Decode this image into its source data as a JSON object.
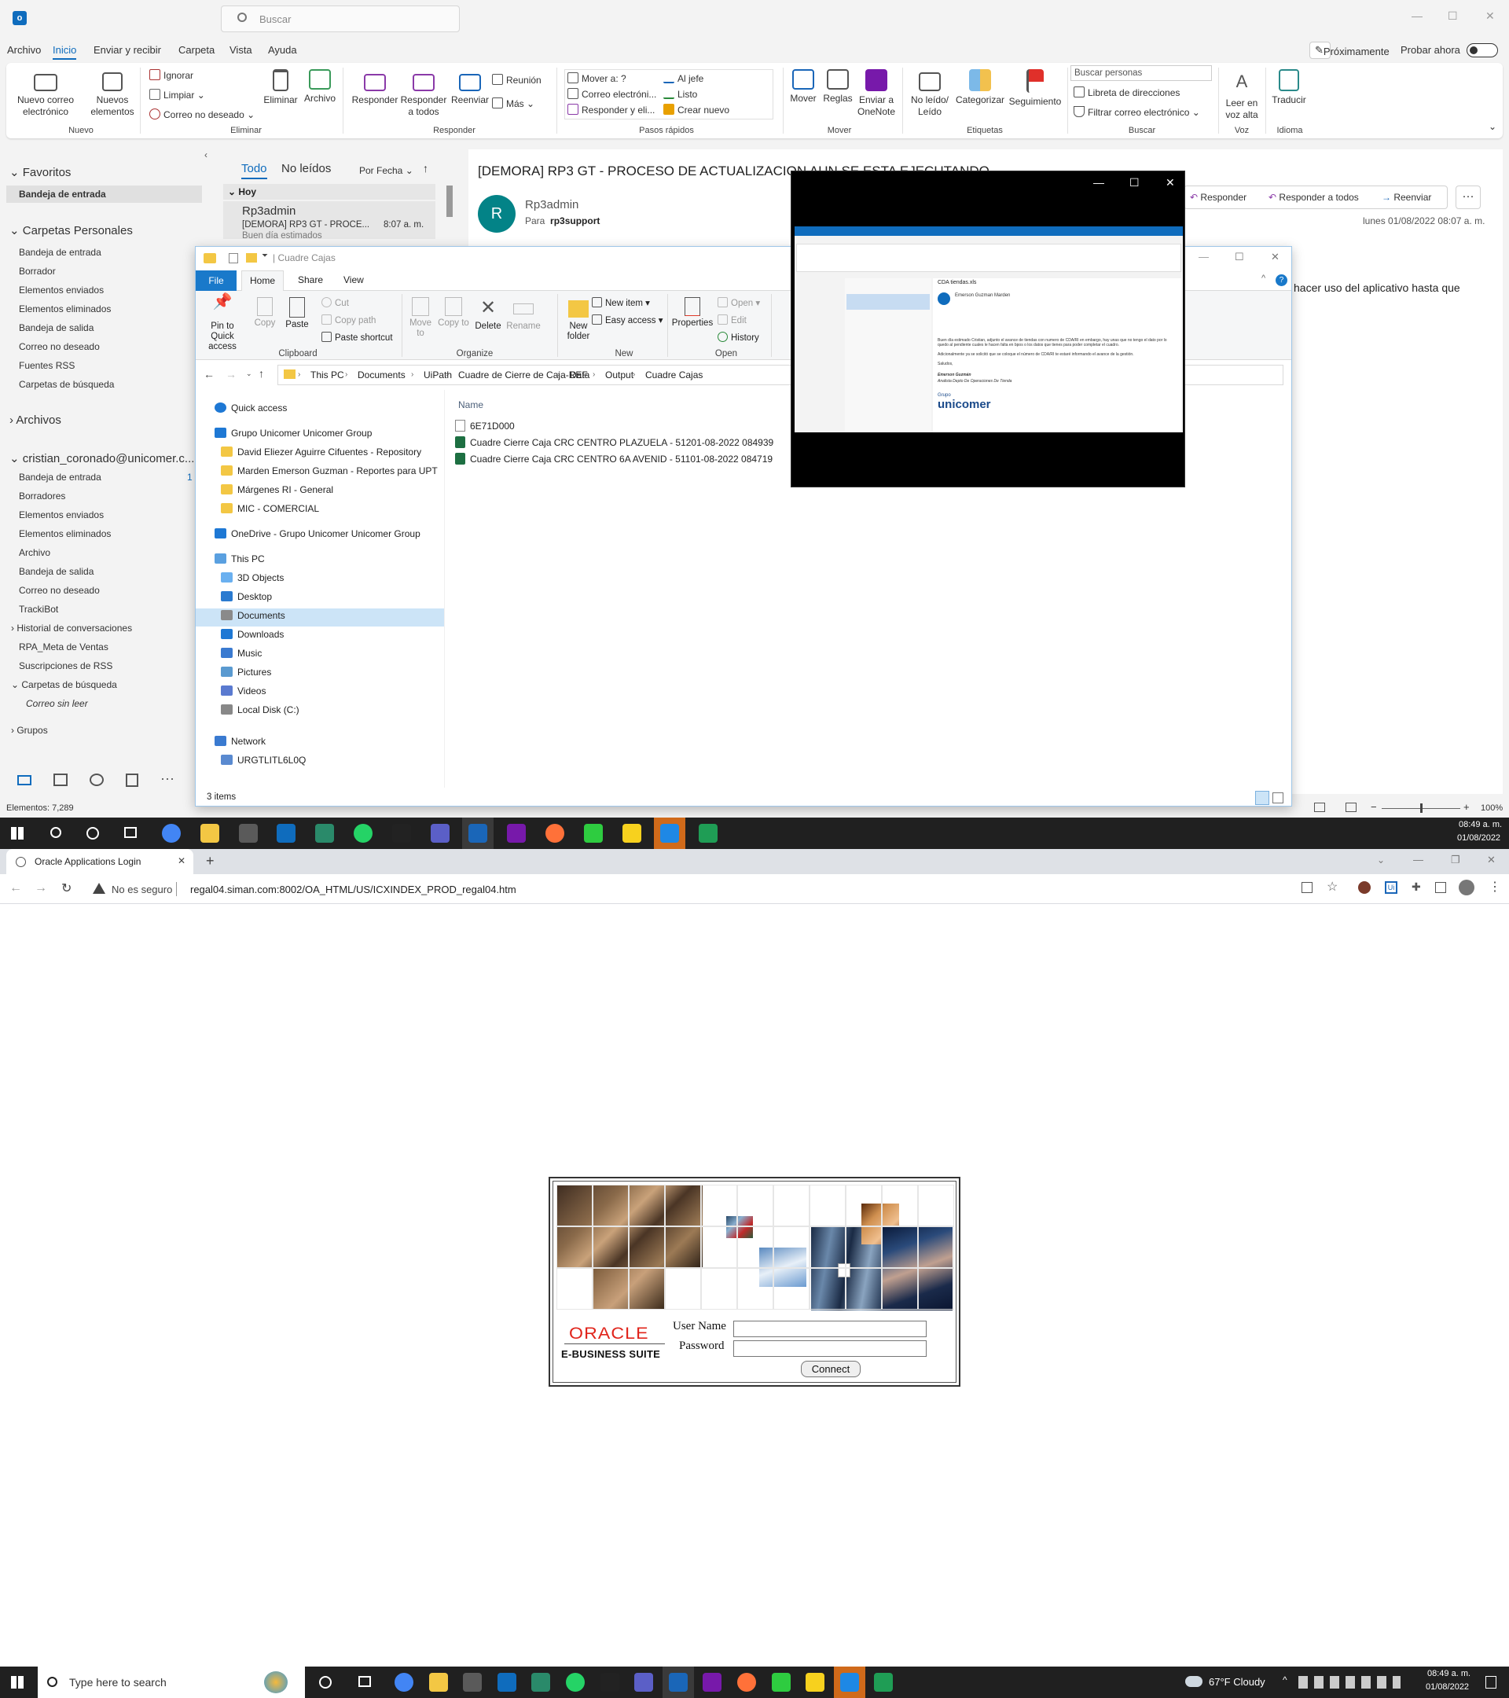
{
  "outlook": {
    "search_placeholder": "Buscar",
    "menu": [
      "Archivo",
      "Inicio",
      "Enviar y recibir",
      "Carpeta",
      "Vista",
      "Ayuda"
    ],
    "proximamente": "Próximamente",
    "probar_ahora": "Probar ahora",
    "ribbon": {
      "nuevo_correo": "Nuevo correo electrónico",
      "nuevos_elementos": "Nuevos elementos",
      "ignorar": "Ignorar",
      "limpiar": "Limpiar",
      "correo_no_deseado": "Correo no deseado",
      "eliminar": "Eliminar",
      "archivo": "Archivo",
      "responder": "Responder",
      "responder_todos": "Responder a todos",
      "reenviar": "Reenviar",
      "reunion": "Reunión",
      "mas": "Más",
      "mover_a": "Mover a: ?",
      "correo_electronico": "Correo electróni...",
      "responder_y_eli": "Responder y eli...",
      "al_jefe": "Al jefe",
      "listo": "Listo",
      "crear_nuevo": "Crear nuevo",
      "mover": "Mover",
      "reglas": "Reglas",
      "enviar_onenote": "Enviar a OneNote",
      "no_leido": "No leído/ Leído",
      "categorizar": "Categorizar",
      "seguimiento": "Seguimiento",
      "buscar_personas": "Buscar personas",
      "libreta": "Libreta de direcciones",
      "filtrar": "Filtrar correo electrónico",
      "leer_voz": "Leer en voz alta",
      "traducir": "Traducir",
      "groups": [
        "Nuevo",
        "Eliminar",
        "Responder",
        "Pasos rápidos",
        "Mover",
        "Etiquetas",
        "Buscar",
        "Voz",
        "Idioma"
      ]
    },
    "folders": {
      "favoritos": "Favoritos",
      "bandeja_fav": "Bandeja de entrada",
      "carpetas_personales": "Carpetas Personales",
      "personal_items": [
        "Bandeja de entrada",
        "Borrador",
        "Elementos enviados",
        "Elementos eliminados",
        "Bandeja de salida",
        "Correo no deseado",
        "Fuentes RSS",
        "Carpetas de búsqueda"
      ],
      "archivos": "Archivos",
      "account": "cristian_coronado@unicomer.c...",
      "account_items": [
        "Bandeja de entrada",
        "Borradores",
        "Elementos enviados",
        "Elementos eliminados",
        "Archivo",
        "Bandeja de salida",
        "Correo no deseado",
        "TrackiBot",
        "Historial de conversaciones",
        "RPA_Meta de Ventas",
        "Suscripciones de RSS",
        "Carpetas de búsqueda"
      ],
      "inbox_count": "1",
      "correo_sin_leer": "Correo sin leer",
      "grupos": "Grupos"
    },
    "list": {
      "todo": "Todo",
      "no_leidos": "No leídos",
      "por_fecha": "Por Fecha",
      "hoy": "Hoy",
      "sender": "Rp3admin",
      "subject": "[DEMORA] RP3 GT - PROCE...",
      "time": "8:07 a. m.",
      "preview": "Buen día estimados"
    },
    "reading": {
      "subject": "[DEMORA] RP3 GT - PROCESO DE ACTUALIZACION AUN SE ESTA EJECUTANDO",
      "avatar": "R",
      "from": "Rp3admin",
      "para_label": "Para",
      "to": "rp3support",
      "responder": "Responder",
      "responder_todos": "Responder a todos",
      "reenviar": "Reenviar",
      "date": "lunes 01/08/2022 08:07 a. m.",
      "body_fragment": "hacer uso del aplicativo hasta que"
    },
    "status": {
      "elementos": "Elementos: 7,289",
      "zoom": "100%"
    }
  },
  "explorer": {
    "title": "Cuadre Cajas",
    "tabs": [
      "File",
      "Home",
      "Share",
      "View"
    ],
    "ribbon": {
      "pin": "Pin to Quick access",
      "copy": "Copy",
      "paste": "Paste",
      "cut": "Cut",
      "copy_path": "Copy path",
      "paste_shortcut": "Paste shortcut",
      "move_to": "Move to",
      "copy_to": "Copy to",
      "delete": "Delete",
      "rename": "Rename",
      "new_folder": "New folder",
      "new_item": "New item",
      "easy_access": "Easy access",
      "properties": "Properties",
      "open": "Open",
      "edit": "Edit",
      "history": "History",
      "groups": [
        "Clipboard",
        "Organize",
        "New",
        "Open"
      ]
    },
    "breadcrumb": [
      "This PC",
      "Documents",
      "UiPath",
      "Cuadre de Cierre de Caja-REF",
      "Data",
      "Output",
      "Cuadre Cajas"
    ],
    "nav": {
      "quick_access": "Quick access",
      "group": "Grupo Unicomer Unicomer Group",
      "group_items": [
        "David Eliezer Aguirre Cifuentes - Repository",
        "Marden Emerson Guzman - Reportes para UPT",
        "Márgenes RI - General",
        "MIC - COMERCIAL"
      ],
      "onedrive": "OneDrive - Grupo Unicomer Unicomer Group",
      "this_pc": "This PC",
      "pc_items": [
        "3D Objects",
        "Desktop",
        "Documents",
        "Downloads",
        "Music",
        "Pictures",
        "Videos",
        "Local Disk (C:)"
      ],
      "network": "Network",
      "network_items": [
        "URGTLITL6L0Q"
      ]
    },
    "column_name": "Name",
    "files": [
      "6E71D000",
      "Cuadre Cierre Caja CRC CENTRO PLAZUELA - 51201-08-2022 084939",
      "Cuadre Cierre Caja CRC CENTRO 6A AVENID - 51101-08-2022 084719"
    ],
    "status": "3 items"
  },
  "blackwin": {
    "thumb_text": [
      "CDA tiendas.xls",
      "Emerson Guzman Marden",
      "Buen día estimado Cristian, adjunto el avance de tiendas con numero de CDA/RI en embargo, hay unas que no tengo el dato por lo quedo al pendiente cuales le hacen falta en bpos o los datos que tienes para poder completar el cuadro.",
      "Adicionalmente ya se solicitó que se coloque el número de CDA/RI te estaré informando el avance de la gestión.",
      "Saludos,",
      "Emerson Guzmán",
      "Analista Depto De Operaciones De Tienda",
      "Grupo",
      "unicomer"
    ]
  },
  "taskbar_top": {
    "time": "08:49 a. m.",
    "date": "01/08/2022"
  },
  "chrome": {
    "tab_title": "Oracle Applications Login",
    "not_secure": "No es seguro",
    "url": "regal04.siman.com:8002/OA_HTML/US/ICXINDEX_PROD_regal04.htm"
  },
  "oracle": {
    "brand": "ORACLE",
    "suite": "E-BUSINESS SUITE",
    "username_label": "User Name",
    "password_label": "Password",
    "username_value": "",
    "password_value": "",
    "connect": "Connect"
  },
  "taskbar_bottom": {
    "search_placeholder": "Type here to search",
    "weather": "67°F  Cloudy",
    "time": "08:49 a. m.",
    "date": "01/08/2022"
  },
  "colors": {
    "outlook_blue": "#0f6cbd",
    "explorer_file_tab": "#1979ca",
    "oracle_red": "#e0241b",
    "taskbar": "#202020"
  }
}
